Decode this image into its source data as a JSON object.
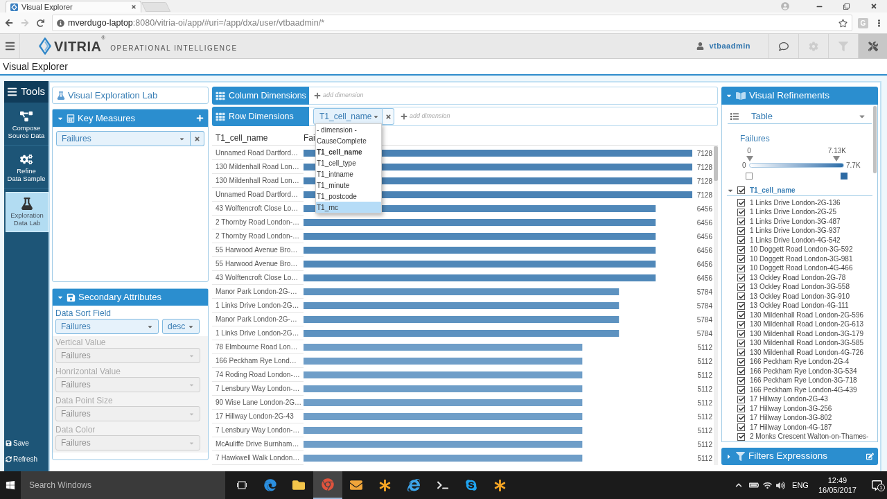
{
  "browser": {
    "tab_title": "Visual Explorer",
    "url_host": "mverdugo-laptop",
    "url_rest": ":8080/vitria-oi/app/#uri=/app/dxa/user/vtbaadmin/*",
    "extension": "G"
  },
  "header": {
    "brand": "VITRIA$^{®}$",
    "tagline": "OPERATIONAL INTELLIGENCE",
    "user": "vtbaadmin",
    "tools": [
      {
        "kind": "chat",
        "disabled": false,
        "active": false
      },
      {
        "kind": "settings",
        "disabled": true,
        "active": false
      },
      {
        "kind": "filter",
        "disabled": true,
        "active": false
      },
      {
        "kind": "tools",
        "disabled": false,
        "active": true
      }
    ]
  },
  "page_title": "Visual Explorer",
  "sidebar": {
    "title": "Tools",
    "items": [
      {
        "kind": "compose",
        "label": "Compose\nSource Data",
        "selected": false
      },
      {
        "kind": "refine",
        "label": "Refine\nData Sample",
        "selected": false
      },
      {
        "kind": "lab",
        "label": "Exploration\nData Lab",
        "selected": true
      }
    ],
    "actions": [
      {
        "kind": "save",
        "label": "Save"
      },
      {
        "kind": "refresh",
        "label": "Refresh"
      }
    ]
  },
  "lab_title": "Visual Exploration Lab",
  "key_measures": {
    "title": "Key Measures",
    "expanded": true,
    "measures": [
      {
        "value": "Failures"
      }
    ]
  },
  "secondary_attributes": {
    "title": "Secondary Attributes",
    "expanded": true,
    "fields": [
      {
        "label": "Data Sort Field",
        "value": "Failures",
        "order": "desc",
        "disabled": false
      },
      {
        "label": "Vertical Value",
        "value": "Failures",
        "disabled": true
      },
      {
        "label": "Honrizontal Value",
        "value": "Failures",
        "disabled": true
      },
      {
        "label": "Data Point Size",
        "value": "Failures",
        "disabled": true
      },
      {
        "label": "Data Color",
        "value": "Failures",
        "disabled": true
      }
    ]
  },
  "column_dimensions": {
    "title": "Column Dimensions",
    "add_label": "add dimension"
  },
  "row_dimensions": {
    "title": "Row Dimensions",
    "items": [
      {
        "value": "T1_cell_name"
      }
    ],
    "add_label": "add dimension"
  },
  "dimension_menu": {
    "items": [
      {
        "label": "- dimension -",
        "selected": false,
        "highlighted": false
      },
      {
        "label": "CauseComplete",
        "selected": false,
        "highlighted": false
      },
      {
        "label": "T1_cell_name",
        "selected": true,
        "highlighted": false
      },
      {
        "label": "T1_cell_type",
        "selected": false,
        "highlighted": false
      },
      {
        "label": "T1_intname",
        "selected": false,
        "highlighted": false
      },
      {
        "label": "T1_minute",
        "selected": false,
        "highlighted": false
      },
      {
        "label": "T1_postcode",
        "selected": false,
        "highlighted": false
      },
      {
        "label": "T1_rnc",
        "selected": false,
        "highlighted": true
      }
    ]
  },
  "table": {
    "columns": [
      "T1_cell_name",
      "Fai"
    ],
    "chart_data": {
      "type": "bar",
      "orientation": "horizontal",
      "data_labels": true,
      "categories": [
        "Unnamed Road Dartford…",
        "130 Mildenhall Road Lon…",
        "130 Mildenhall Road Lon…",
        "Unnamed Road Dartford…",
        "43 Wolftencroft Close Lo…",
        "2 Thornby Road London-…",
        "2 Thornby Road London-…",
        "55 Harwood Avenue Bro…",
        "55 Harwood Avenue Bro…",
        "43 Wolftencroft Close Lo…",
        "Manor Park London-2G-…",
        "1 Links Drive London-2G…",
        "Manor Park London-2G-…",
        "1 Links Drive London-2G…",
        "78 Elmbourne Road Lon…",
        "166 Peckham Rye Lond…",
        "74 Roding Road London-…",
        "7 Lensbury Way London-…",
        "90 Wise Lane London-2G…",
        "17 Hillway London-2G-43",
        "7 Lensbury Way London-…",
        "McAuliffe Drive Burnham…",
        "7 Hawkwell Walk London…"
      ],
      "values": [
        7128,
        7128,
        7128,
        7128,
        6456,
        6456,
        6456,
        6456,
        6456,
        6456,
        5784,
        5784,
        5784,
        5784,
        5112,
        5112,
        5112,
        5112,
        5112,
        5112,
        5112,
        5112,
        5112
      ],
      "colors": [
        "#4a82b4",
        "#4a82b4",
        "#4a82b4",
        "#4a82b4",
        "#5088b9",
        "#5088b9",
        "#5088b9",
        "#5088b9",
        "#5088b9",
        "#5088b9",
        "#5d92c0",
        "#5d92c0",
        "#5d92c0",
        "#5d92c0",
        "#6f9ec8",
        "#6f9ec8",
        "#6f9ec8",
        "#6f9ec8",
        "#6f9ec8",
        "#6f9ec8",
        "#6f9ec8",
        "#6f9ec8",
        "#6f9ec8"
      ]
    }
  },
  "refinements": {
    "title": "Visual Refinements",
    "expanded": true,
    "view": "Table",
    "legend": {
      "title": "Failures",
      "min": "0",
      "max": "7.7K",
      "handles": [
        {
          "label": "0",
          "level": 0
        },
        {
          "label": "7.13K",
          "level": 0.926
        }
      ]
    },
    "tree": {
      "label": "T1_cell_name",
      "checked": true,
      "expanded": true,
      "children": [
        {
          "label": "1 Links Drive London-2G-136",
          "checked": true
        },
        {
          "label": "1 Links Drive London-2G-25",
          "checked": true
        },
        {
          "label": "1 Links Drive London-3G-487",
          "checked": true
        },
        {
          "label": "1 Links Drive London-3G-937",
          "checked": true
        },
        {
          "label": "1 Links Drive London-4G-542",
          "checked": true
        },
        {
          "label": "10 Doggett Road London-3G-592",
          "checked": true
        },
        {
          "label": "10 Doggett Road London-3G-981",
          "checked": true
        },
        {
          "label": "10 Doggett Road London-4G-466",
          "checked": true
        },
        {
          "label": "13 Ockley Road London-2G-78",
          "checked": true
        },
        {
          "label": "13 Ockley Road London-3G-558",
          "checked": true
        },
        {
          "label": "13 Ockley Road London-3G-910",
          "checked": true
        },
        {
          "label": "13 Ockley Road London-4G-111",
          "checked": true
        },
        {
          "label": "130 Mildenhall Road London-2G-596",
          "checked": true
        },
        {
          "label": "130 Mildenhall Road London-2G-613",
          "checked": true
        },
        {
          "label": "130 Mildenhall Road London-3G-179",
          "checked": true
        },
        {
          "label": "130 Mildenhall Road London-3G-585",
          "checked": true
        },
        {
          "label": "130 Mildenhall Road London-4G-726",
          "checked": true
        },
        {
          "label": "166 Peckham Rye London-2G-4",
          "checked": true
        },
        {
          "label": "166 Peckham Rye London-3G-534",
          "checked": true
        },
        {
          "label": "166 Peckham Rye London-3G-718",
          "checked": true
        },
        {
          "label": "166 Peckham Rye London-4G-439",
          "checked": true
        },
        {
          "label": "17 Hillway London-2G-43",
          "checked": true
        },
        {
          "label": "17 Hillway London-3G-256",
          "checked": true
        },
        {
          "label": "17 Hillway London-3G-802",
          "checked": true
        },
        {
          "label": "17 Hillway London-4G-187",
          "checked": true
        },
        {
          "label": "2 Monks Crescent Walton-on-Thames-",
          "checked": true
        }
      ]
    }
  },
  "filters": {
    "title": "Filters Expressions",
    "expanded": false
  },
  "taskbar": {
    "placeholder": "Search Windows",
    "apps": [
      {
        "kind": "edge",
        "selected": false
      },
      {
        "kind": "folder",
        "selected": false
      },
      {
        "kind": "chrome",
        "selected": true
      },
      {
        "kind": "mail",
        "selected": false
      },
      {
        "kind": "asterisk",
        "selected": false
      },
      {
        "kind": "ie",
        "selected": false
      },
      {
        "kind": "terminal",
        "selected": false
      },
      {
        "kind": "skype",
        "selected": false
      },
      {
        "kind": "asterisk",
        "selected": false
      }
    ],
    "language": "ENG",
    "time": "12:49",
    "date": "16/05/2017",
    "notifications": "1"
  }
}
